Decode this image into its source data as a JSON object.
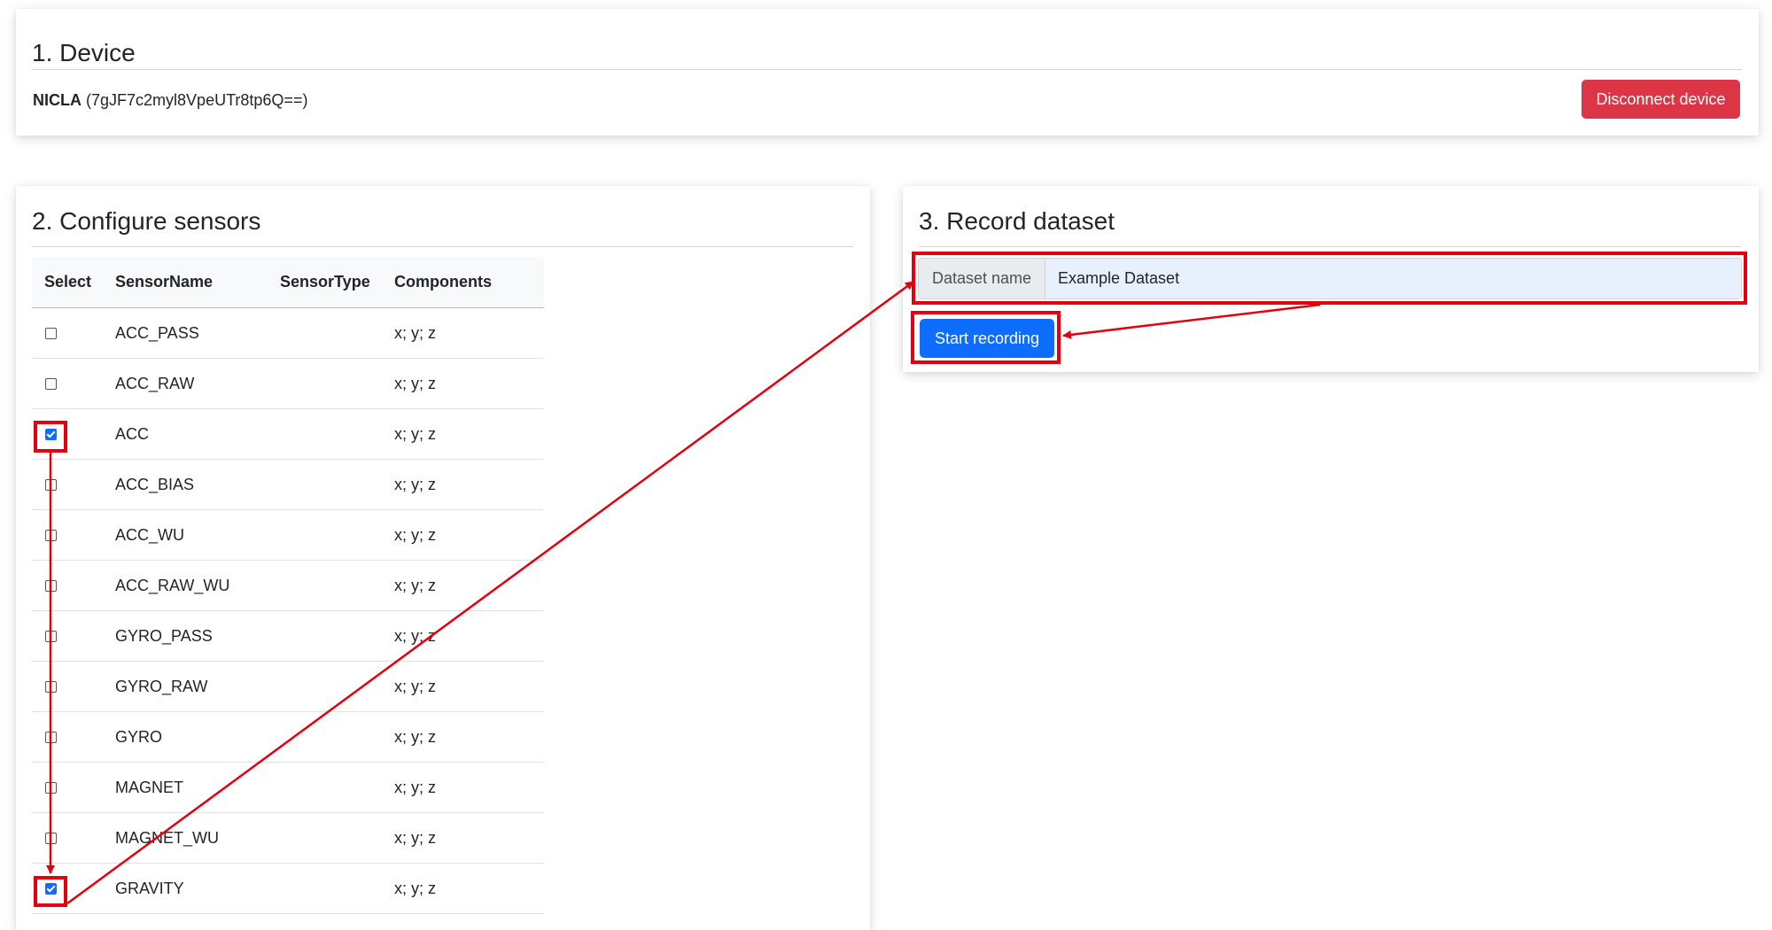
{
  "device": {
    "title": "1. Device",
    "name": "NICLA",
    "id_text": "(7gJF7c2myl8VpeUTr8tp6Q==)",
    "disconnect_label": "Disconnect device"
  },
  "sensors": {
    "title": "2. Configure sensors",
    "headers": [
      "Select",
      "SensorName",
      "SensorType",
      "Components"
    ],
    "rows": [
      {
        "name": "ACC_PASS",
        "type": "",
        "components": "x; y; z",
        "checked": false
      },
      {
        "name": "ACC_RAW",
        "type": "",
        "components": "x; y; z",
        "checked": false
      },
      {
        "name": "ACC",
        "type": "",
        "components": "x; y; z",
        "checked": true
      },
      {
        "name": "ACC_BIAS",
        "type": "",
        "components": "x; y; z",
        "checked": false
      },
      {
        "name": "ACC_WU",
        "type": "",
        "components": "x; y; z",
        "checked": false
      },
      {
        "name": "ACC_RAW_WU",
        "type": "",
        "components": "x; y; z",
        "checked": false
      },
      {
        "name": "GYRO_PASS",
        "type": "",
        "components": "x; y; z",
        "checked": false
      },
      {
        "name": "GYRO_RAW",
        "type": "",
        "components": "x; y; z",
        "checked": false
      },
      {
        "name": "GYRO",
        "type": "",
        "components": "x; y; z",
        "checked": false
      },
      {
        "name": "MAGNET",
        "type": "",
        "components": "x; y; z",
        "checked": false
      },
      {
        "name": "MAGNET_WU",
        "type": "",
        "components": "x; y; z",
        "checked": false
      },
      {
        "name": "GRAVITY",
        "type": "",
        "components": "x; y; z",
        "checked": true
      }
    ]
  },
  "record": {
    "title": "3. Record dataset",
    "dataset_label": "Dataset name",
    "dataset_value": "Example Dataset",
    "start_label": "Start recording"
  },
  "colors": {
    "danger": "#dc3545",
    "primary": "#0d6efd",
    "annotation": "#e3000f"
  }
}
